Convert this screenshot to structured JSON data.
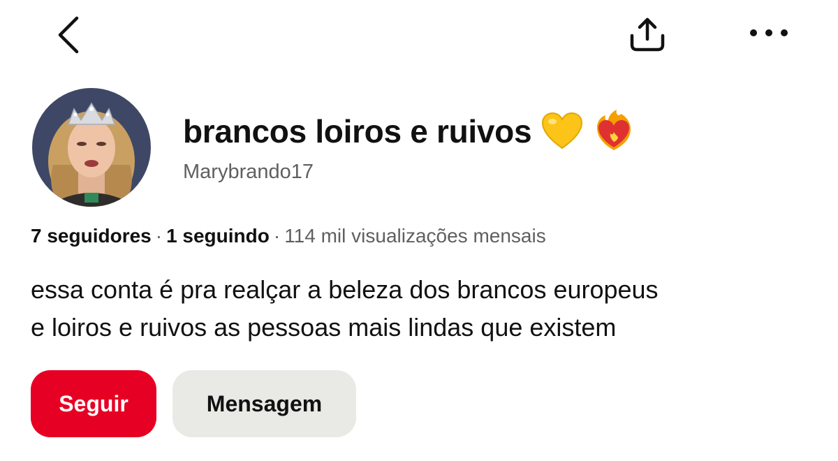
{
  "header": {
    "back_icon": "chevron-left-icon",
    "share_icon": "share-upload-icon",
    "more_icon": "more-horizontal-icon"
  },
  "profile": {
    "name": "brancos loiros e ruivos",
    "emojis": [
      "yellow-heart-emoji",
      "heart-on-fire-emoji"
    ],
    "username": "Marybrando17",
    "avatar": "avatar-photo"
  },
  "stats": {
    "followers": "7 seguidores",
    "following": "1 seguindo",
    "views": "114 mil visualizações mensais",
    "separator": "·"
  },
  "bio": {
    "line1": "essa conta é pra realçar a beleza dos brancos europeus",
    "line2": "e loiros e ruivos as pessoas mais lindas que existem"
  },
  "actions": {
    "follow_label": "Seguir",
    "message_label": "Mensagem"
  },
  "colors": {
    "accent": "#e60023",
    "secondary_button": "#e9e9e6",
    "text_primary": "#111111",
    "text_muted": "#5f5f5f"
  }
}
